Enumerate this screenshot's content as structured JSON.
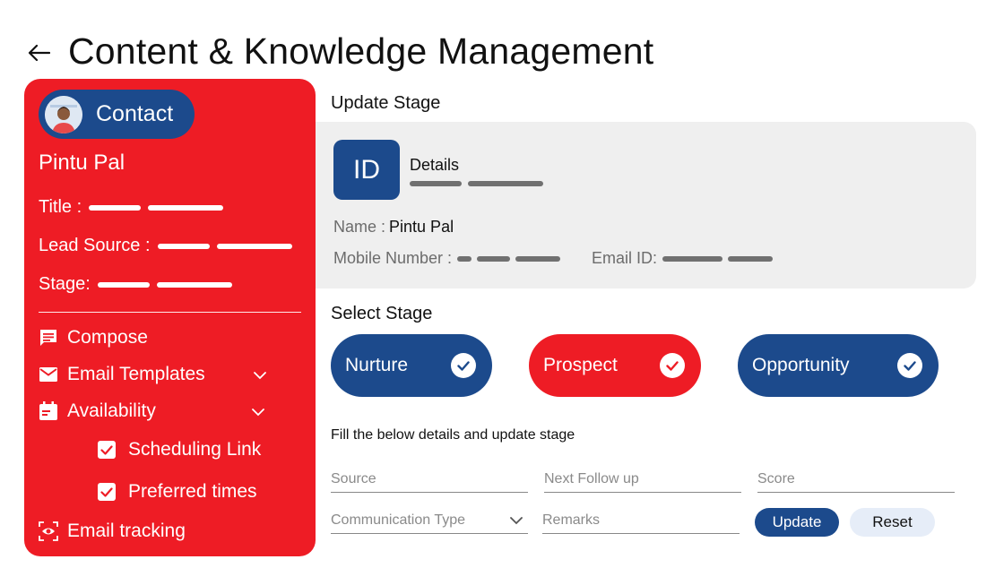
{
  "header": {
    "title": "Content & Knowledge Management"
  },
  "sidebar": {
    "contact_label": "Contact",
    "person_name": "Pintu Pal",
    "fields": {
      "title_label": "Title :",
      "lead_source_label": "Lead Source :",
      "stage_label": "Stage:"
    },
    "menu": {
      "compose": "Compose",
      "email_templates": "Email Templates",
      "availability": "Availability",
      "scheduling_link": "Scheduling Link",
      "preferred_times": "Preferred times",
      "email_tracking": "Email tracking"
    }
  },
  "update_stage": {
    "title": "Update Stage",
    "card": {
      "id_badge": "ID",
      "details_label": "Details",
      "name_label": "Name :",
      "name_value": "Pintu Pal",
      "mobile_label": "Mobile Number :",
      "email_label": "Email ID:"
    }
  },
  "select_stage": {
    "title": "Select Stage",
    "stages": [
      {
        "label": "Nurture",
        "color": "#1c4a8c"
      },
      {
        "label": "Prospect",
        "color": "#ee1c25"
      },
      {
        "label": "Opportunity",
        "color": "#1c4a8c"
      }
    ]
  },
  "form": {
    "instruction": "Fill the below details and update stage",
    "source_placeholder": "Source",
    "next_follow_up_placeholder": "Next Follow up",
    "score_placeholder": "Score",
    "communication_type_placeholder": "Communication Type",
    "remarks_placeholder": "Remarks",
    "update_label": "Update",
    "reset_label": "Reset"
  },
  "colors": {
    "brand_red": "#ee1c25",
    "brand_blue": "#1c4a8c",
    "card_gray": "#efefef"
  }
}
